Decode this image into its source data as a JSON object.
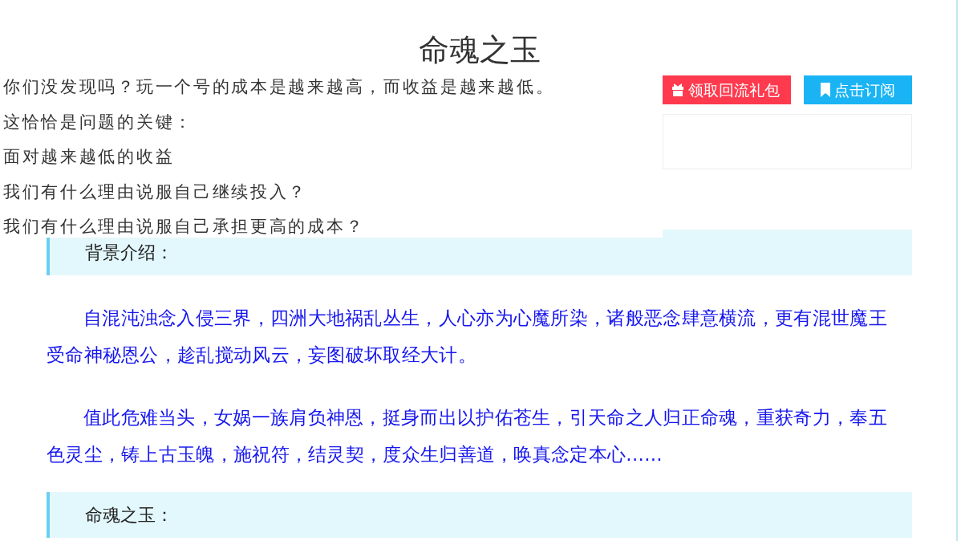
{
  "title": "命魂之玉",
  "overlay_lines": [
    "你们没发现吗？玩一个号的成本是越来越高，而收益是越来越低。",
    "这恰恰是问题的关键：",
    "面对越来越低的收益",
    "我们有什么理由说服自己继续投入？",
    "我们有什么理由说服自己承担更高的成本？"
  ],
  "buttons": [
    {
      "kind": "gift",
      "label": "领取回流礼包"
    },
    {
      "kind": "subscribe",
      "label": "点击订阅"
    }
  ],
  "sections": [
    {
      "heading": "背景介绍：",
      "paragraphs": [
        "自混沌浊念入侵三界，四洲大地祸乱丛生，人心亦为心魔所染，诸般恶念肆意横流，更有混世魔王受命神秘恩公，趁乱搅动风云，妄图破坏取经大计。",
        "值此危难当头，女娲一族肩负神恩，挺身而出以护佑苍生，引天命之人归正命魂，重获奇力，奉五色灵尘，铸上古玉魄，施祝符，结灵契，度众生归善道，唤真念定本心......"
      ]
    },
    {
      "heading": "命魂之玉："
    }
  ]
}
